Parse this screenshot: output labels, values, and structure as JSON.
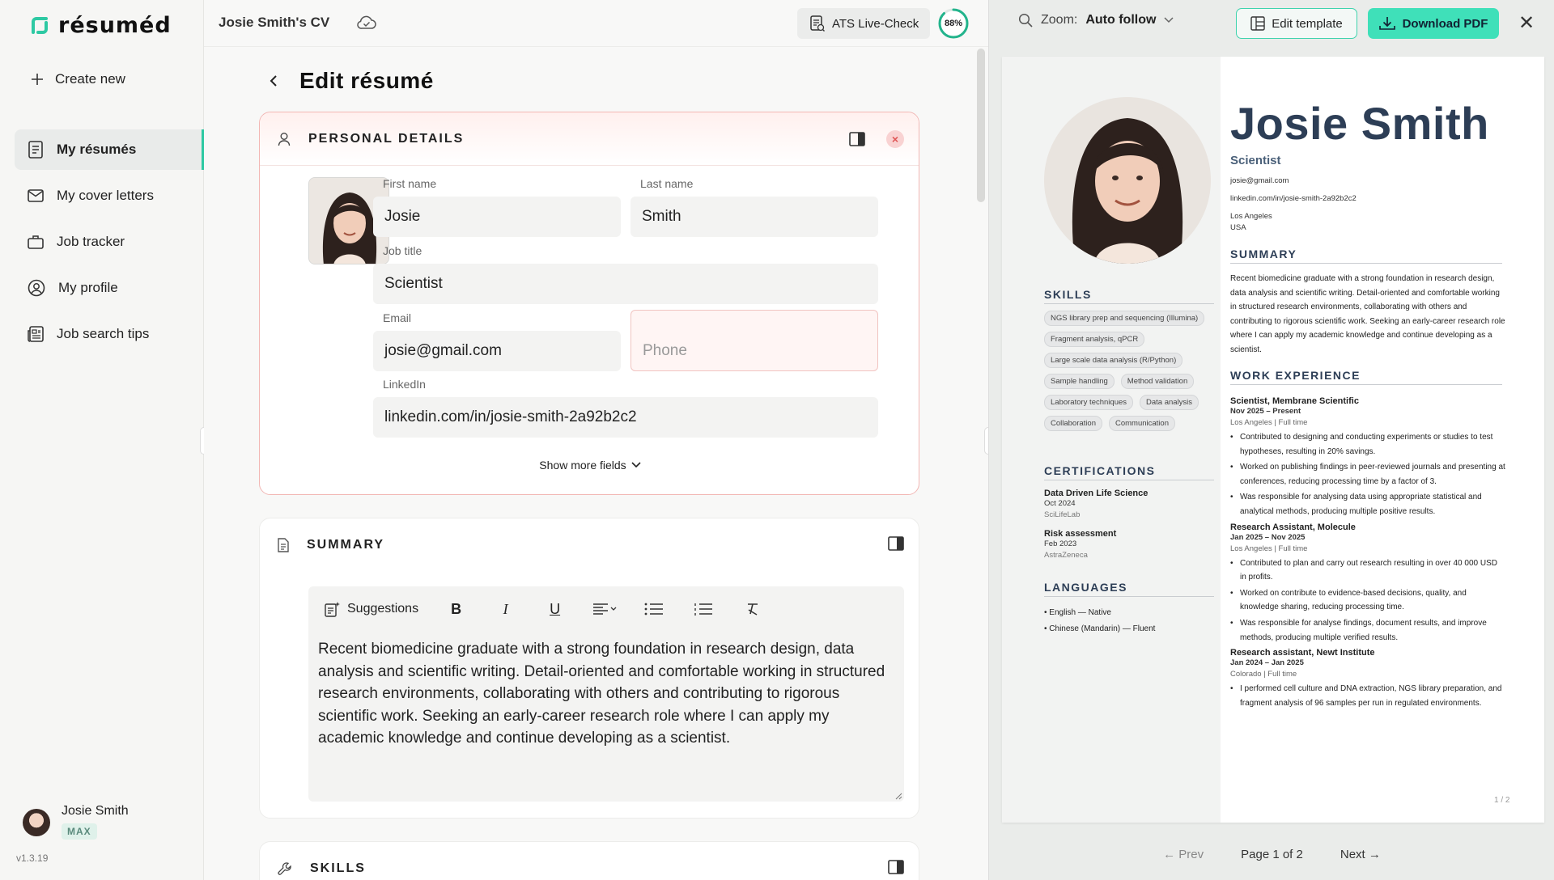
{
  "brand": {
    "name": "résuméd"
  },
  "sidebar": {
    "create_label": "Create new",
    "items": [
      {
        "label": "My résumés",
        "icon": "document-icon",
        "active": true
      },
      {
        "label": "My cover letters",
        "icon": "mail-icon"
      },
      {
        "label": "Job tracker",
        "icon": "briefcase-icon"
      },
      {
        "label": "My profile",
        "icon": "user-circle-icon"
      },
      {
        "label": "Job search tips",
        "icon": "newspaper-icon"
      }
    ],
    "user": {
      "name": "Josie Smith",
      "plan": "MAX"
    },
    "version": "v1.3.19"
  },
  "editor": {
    "cv_title": "Josie Smith's CV",
    "ats_label": "ATS Live-Check",
    "ats_score": "88%",
    "ats_score_value": 0.88,
    "page_title": "Edit résumé",
    "personal": {
      "title": "PERSONAL DETAILS",
      "first_name_label": "First name",
      "first_name": "Josie",
      "last_name_label": "Last name",
      "last_name": "Smith",
      "job_title_label": "Job title",
      "job_title": "Scientist",
      "email_label": "Email",
      "email": "josie@gmail.com",
      "phone_placeholder": "Phone",
      "linkedin_label": "LinkedIn",
      "linkedin": "linkedin.com/in/josie-smith-2a92b2c2",
      "show_more": "Show more fields"
    },
    "summary": {
      "title": "SUMMARY",
      "suggestions_label": "Suggestions",
      "text": "Recent biomedicine graduate with a strong foundation in research design, data analysis and scientific writing. Detail-oriented and comfortable working in structured research environments, collaborating with others and contributing to rigorous scientific work. Seeking an early-career research role where I can apply my academic knowledge and continue developing as a scientist."
    },
    "skills": {
      "title": "SKILLS"
    }
  },
  "preview": {
    "zoom_label": "Zoom:",
    "zoom_value": "Auto follow",
    "edit_template": "Edit template",
    "download": "Download PDF",
    "prev": "← Prev",
    "page": "Page 1 of 2",
    "next": "Next →",
    "page_number": "1 / 2"
  },
  "resume": {
    "name": "Josie Smith",
    "title": "Scientist",
    "email": "josie@gmail.com",
    "linkedin": "linkedin.com/in/josie-smith-2a92b2c2",
    "city": "Los Angeles",
    "country": "USA",
    "skills_title": "SKILLS",
    "skills": [
      "NGS library prep and sequencing (Illumina)",
      "Fragment analysis, qPCR",
      "Large scale data analysis (R/Python)",
      "Sample handling",
      "Method validation",
      "Laboratory techniques",
      "Data analysis",
      "Collaboration",
      "Communication"
    ],
    "certs_title": "CERTIFICATIONS",
    "certs": [
      {
        "name": "Data Driven Life Science",
        "date": "Oct 2024",
        "org": "SciLifeLab"
      },
      {
        "name": "Risk assessment",
        "date": "Feb 2023",
        "org": "AstraZeneca"
      }
    ],
    "langs_title": "LANGUAGES",
    "langs": [
      "• English — Native",
      "• Chinese (Mandarin) — Fluent"
    ],
    "summary_title": "SUMMARY",
    "summary": "Recent biomedicine graduate with a strong foundation in research design, data analysis and scientific writing. Detail-oriented and comfortable working in structured research environments, collaborating with others and contributing to rigorous scientific work. Seeking an early-career research role where I can apply my academic knowledge and continue developing as a scientist.",
    "work_title": "WORK EXPERIENCE",
    "jobs": [
      {
        "title": "Scientist, Membrane Scientific",
        "dates": "Nov 2025 – Present",
        "loc": "Los Angeles | Full time",
        "bullets": [
          "Contributed to designing and conducting experiments or studies to test hypotheses, resulting in 20% savings.",
          "Worked on publishing findings in peer-reviewed journals and presenting at conferences, reducing processing time by a factor of 3.",
          "Was responsible for analysing data using appropriate statistical and analytical methods, producing multiple positive results."
        ]
      },
      {
        "title": "Research Assistant, Molecule",
        "dates": "Jan 2025 – Nov 2025",
        "loc": "Los Angeles | Full time",
        "bullets": [
          "Contributed to plan and carry out research resulting in over 40 000 USD in profits.",
          "Worked on contribute to evidence-based decisions, quality, and knowledge sharing, reducing processing time.",
          "Was responsible for analyse findings, document results, and improve methods, producing multiple verified results."
        ]
      },
      {
        "title": "Research assistant, Newt Institute",
        "dates": "Jan 2024 – Jan 2025",
        "loc": "Colorado | Full time",
        "bullets": [
          "I performed cell culture and DNA extraction, NGS library preparation, and fragment analysis of 96 samples per run in regulated environments."
        ]
      }
    ]
  }
}
